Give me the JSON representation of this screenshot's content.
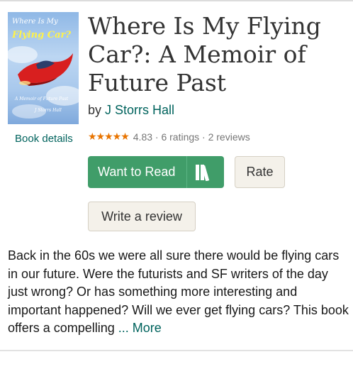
{
  "book": {
    "title": "Where Is My Flying Car?: A Memoir of Future Past",
    "by_prefix": "by",
    "author": "J Storrs Hall",
    "details_link": "Book details",
    "stars": "★★★★★",
    "rating_text": "4.83 · 6 ratings · 2 reviews"
  },
  "cover": {
    "line1": "Where Is My",
    "line2": "Flying Car?",
    "line3": "A Memoir of Future Past",
    "line4": "J Storrs Hall"
  },
  "actions": {
    "want_to_read": "Want to Read",
    "rate": "Rate",
    "write_review": "Write a review"
  },
  "description": {
    "text": "Back in the 60s we were all sure there would be flying cars in our future. Were the futurists and SF writers of the day just wrong? Or has something more interesting and important happened? Will we ever get flying cars? This book offers a compelling",
    "more": "... More"
  },
  "colors": {
    "accent_green": "#409d69",
    "link_teal": "#00635d",
    "star_orange": "#e87400",
    "button_beige": "#f4f1ea"
  }
}
